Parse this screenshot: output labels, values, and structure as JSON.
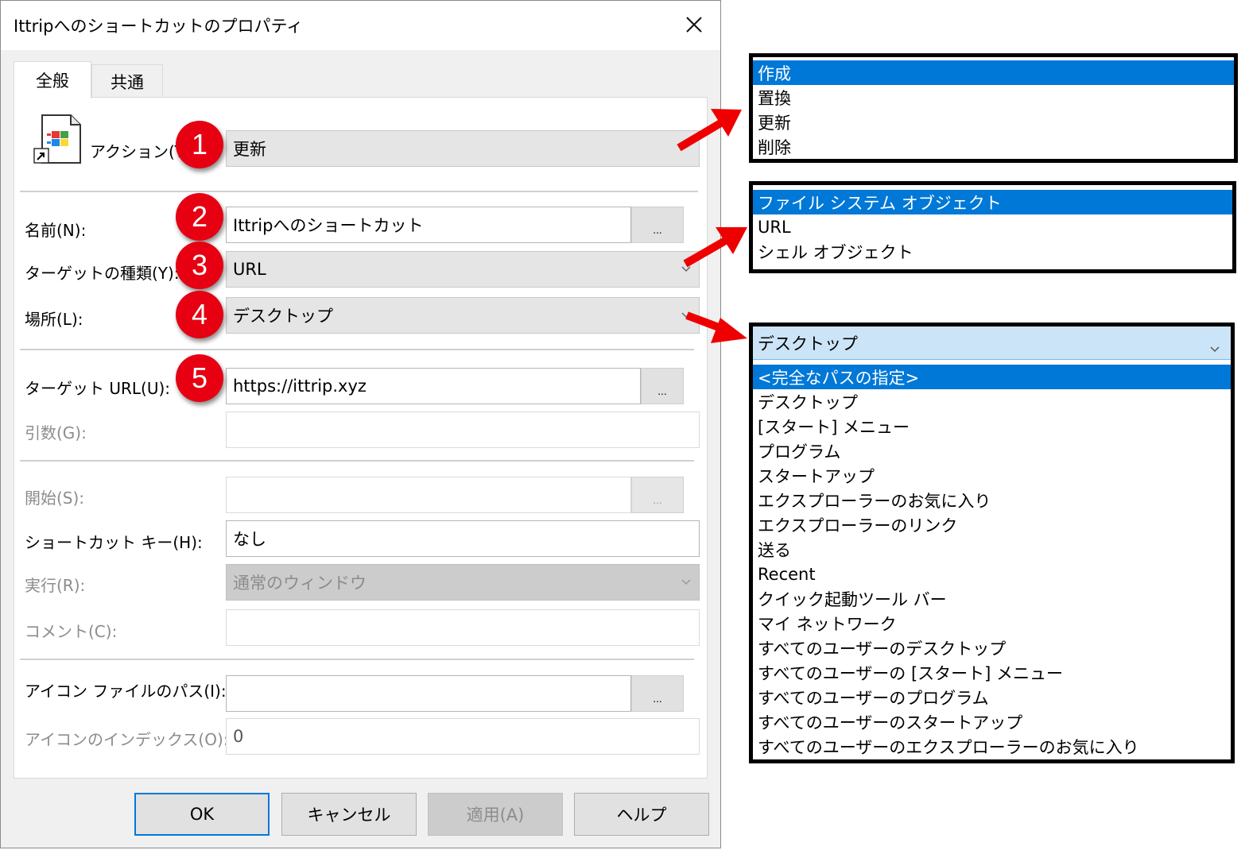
{
  "dialog": {
    "title": "Ittripへのショートカットのプロパティ",
    "tabs": [
      {
        "label": "全般"
      },
      {
        "label": "共通"
      }
    ],
    "fields": {
      "action": {
        "label": "アクション(T):",
        "value": "更新"
      },
      "name": {
        "label": "名前(N):",
        "value": "Ittripへのショートカット"
      },
      "target_type": {
        "label": "ターゲットの種類(Y):",
        "value": "URL"
      },
      "location": {
        "label": "場所(L):",
        "value": "デスクトップ"
      },
      "target_url": {
        "label": "ターゲット URL(U):",
        "value": "https://ittrip.xyz"
      },
      "arguments": {
        "label": "引数(G):",
        "value": ""
      },
      "start_in": {
        "label": "開始(S):",
        "value": ""
      },
      "shortcut_key": {
        "label": "ショートカット キー(H):",
        "value": "なし"
      },
      "run": {
        "label": "実行(R):",
        "value": "通常のウィンドウ"
      },
      "comment": {
        "label": "コメント(C):",
        "value": ""
      },
      "icon_path": {
        "label": "アイコン ファイルのパス(I):",
        "value": ""
      },
      "icon_index": {
        "label": "アイコンのインデックス(O):",
        "value": "0"
      }
    },
    "browse_label": "...",
    "buttons": {
      "ok": "OK",
      "cancel": "キャンセル",
      "apply": "適用(A)",
      "help": "ヘルプ"
    }
  },
  "badges": [
    "1",
    "2",
    "3",
    "4",
    "5"
  ],
  "dropdowns": {
    "action_options": [
      "作成",
      "置換",
      "更新",
      "削除"
    ],
    "target_type_options": [
      "ファイル システム オブジェクト",
      "URL",
      "シェル オブジェクト"
    ],
    "location": {
      "selected": "デスクトップ",
      "options": [
        "<完全なパスの指定>",
        "デスクトップ",
        "[スタート] メニュー",
        "プログラム",
        "スタートアップ",
        "エクスプローラーのお気に入り",
        "エクスプローラーのリンク",
        "送る",
        "Recent",
        "クイック起動ツール バー",
        "マイ ネットワーク",
        "すべてのユーザーのデスクトップ",
        "すべてのユーザーの [スタート] メニュー",
        "すべてのユーザーのプログラム",
        "すべてのユーザーのスタートアップ",
        "すべてのユーザーのエクスプローラーのお気に入り"
      ]
    }
  },
  "colors": {
    "selection": "#0078d7",
    "badge": "#e60012",
    "arrow": "#ee0000",
    "combo_head": "#cce4f7"
  },
  "icons": {
    "close": "close-icon",
    "shortcut": "shortcut-file-icon",
    "dropdown": "chevron-down-icon"
  }
}
